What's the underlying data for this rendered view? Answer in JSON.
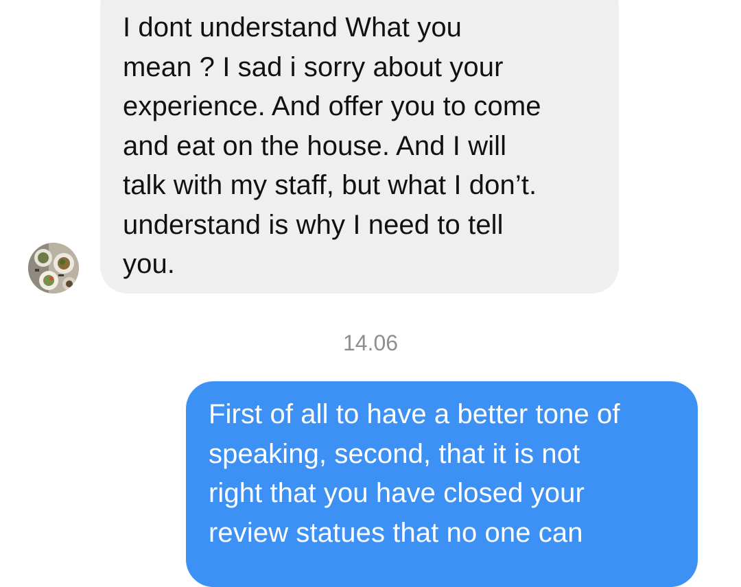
{
  "colors": {
    "incoming_bubble": "#efefef",
    "outgoing_bubble": "#3d91f5",
    "incoming_text": "#111111",
    "outgoing_text": "#ffffff",
    "timestamp": "#8e8e93"
  },
  "messages": [
    {
      "direction": "incoming",
      "text": "I dont understand What you\nmean ? I sad i sorry about your\nexperience. And offer you to come\nand eat on the house. And I will\ntalk with my staff, but what I don’t.\nunderstand is why I need to tell\nyou.",
      "avatar_icon": "food-photo-avatar"
    },
    {
      "direction": "timestamp",
      "text": "14.06"
    },
    {
      "direction": "outgoing",
      "text": "First of all to have a better tone of\nspeaking, second, that it is not\nright that you have closed your\nreview statues that no one can"
    }
  ]
}
